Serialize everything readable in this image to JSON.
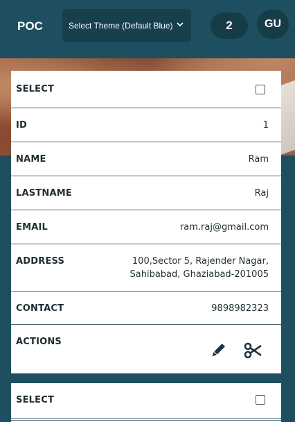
{
  "header": {
    "brand": "POC",
    "theme_select": {
      "value": "Select Theme (Default Blue)",
      "icon": "chevron-down-icon"
    },
    "count": "2",
    "avatar": "GU"
  },
  "records": [
    {
      "select_label": "SELECT",
      "id_label": "ID",
      "id": "1",
      "name_label": "NAME",
      "name": "Ram",
      "lastname_label": "LASTNAME",
      "lastname": "Raj",
      "email_label": "EMAIL",
      "email": "ram.raj@gmail.com",
      "address_label": "ADDRESS",
      "address_line1": "100,Sector 5, Rajender Nagar,",
      "address_line2": "Sahibabad, Ghaziabad-201005",
      "contact_label": "CONTACT",
      "contact": "9898982323",
      "actions_label": "ACTIONS",
      "actions": [
        "edit-pencil-icon",
        "delete-scissors-icon"
      ]
    },
    {
      "select_label": "SELECT"
    }
  ]
}
